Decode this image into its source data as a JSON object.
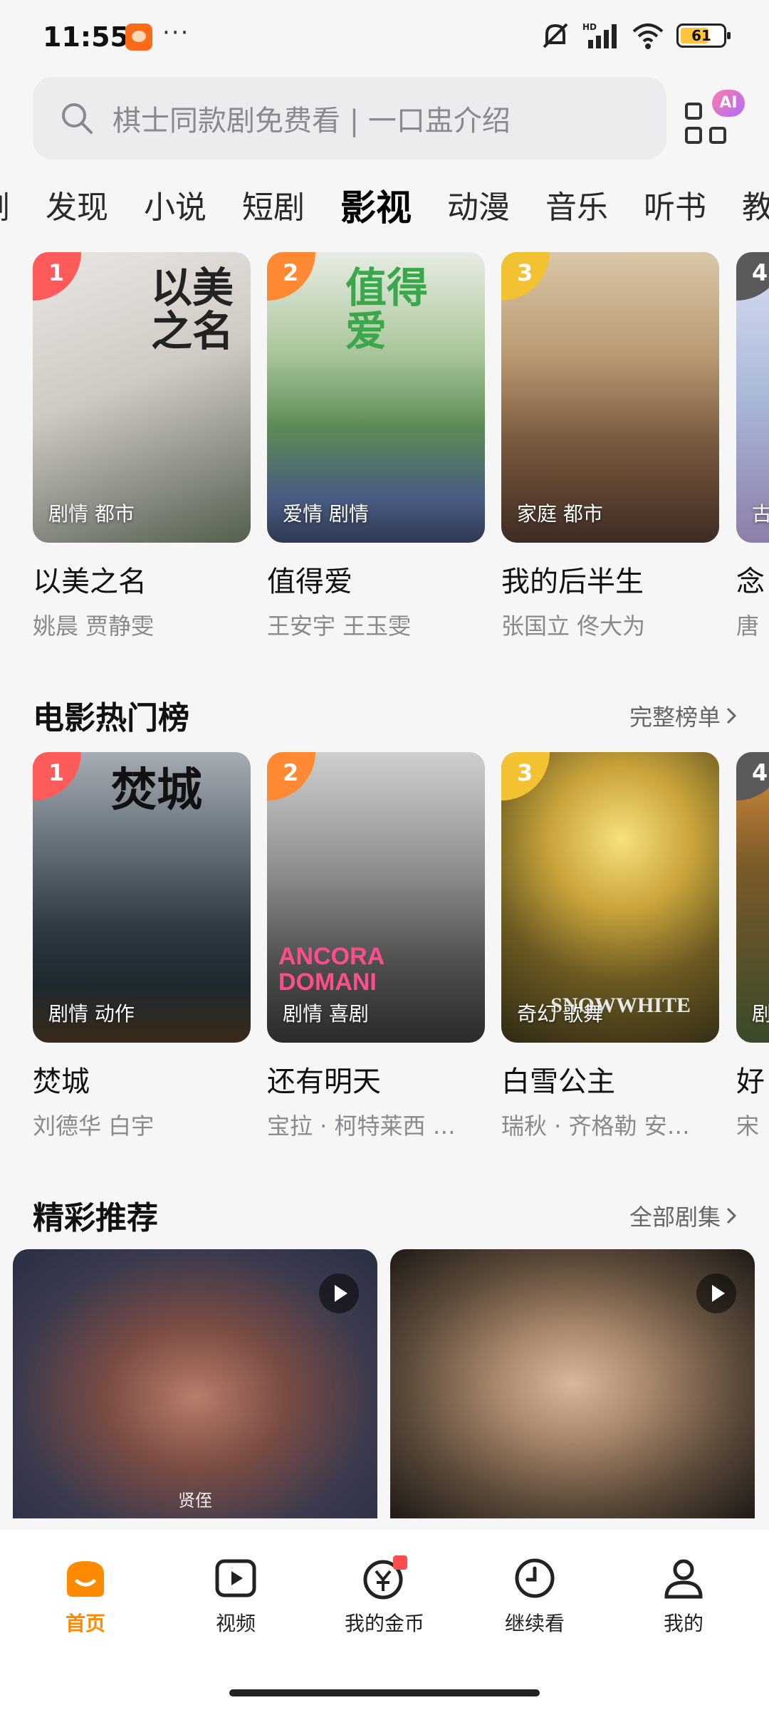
{
  "status_bar": {
    "time": "11:55",
    "dots": "···",
    "battery": "61",
    "battery_level": 0.61
  },
  "search": {
    "placeholder": "棋士同款剧免费看 | 一口盅介绍",
    "ai_badge": "AI"
  },
  "tabs": [
    {
      "label": "剧"
    },
    {
      "label": "发现"
    },
    {
      "label": "小说"
    },
    {
      "label": "短剧"
    },
    {
      "label": "影视",
      "active": true
    },
    {
      "label": "动漫"
    },
    {
      "label": "音乐"
    },
    {
      "label": "听书"
    },
    {
      "label": "教"
    }
  ],
  "drama_row": [
    {
      "rank": "1",
      "genre": "剧情 都市",
      "title": "以美之名",
      "cast": "姚晨 贾静雯",
      "art": "以美\n之名"
    },
    {
      "rank": "2",
      "genre": "爱情 剧情",
      "title": "值得爱",
      "cast": "王安宇 王玉雯",
      "art": "值得\n爱"
    },
    {
      "rank": "3",
      "genre": "家庭 都市",
      "title": "我的后半生",
      "cast": "张国立 佟大为",
      "art": ""
    },
    {
      "rank": "4",
      "genre": "古",
      "title": "念",
      "cast": "唐",
      "art": ""
    }
  ],
  "movie_section": {
    "title": "电影热门榜",
    "more": "完整榜单"
  },
  "movie_row": [
    {
      "rank": "1",
      "genre": "剧情 动作",
      "title": "焚城",
      "cast": "刘德华 白宇",
      "art": "焚城"
    },
    {
      "rank": "2",
      "genre": "剧情 喜剧",
      "title": "还有明天",
      "cast": "宝拉 · 柯特莱西 …",
      "art": "ANCORA DOMANI"
    },
    {
      "rank": "3",
      "genre": "奇幻 歌舞",
      "title": "白雪公主",
      "cast": "瑞秋 · 齐格勒 安…",
      "art": "SNOWWHITE"
    },
    {
      "rank": "4",
      "genre": "剧",
      "title": "好",
      "cast": "宋",
      "art": ""
    }
  ],
  "rec_section": {
    "title": "精彩推荐",
    "more": "全部剧集"
  },
  "rec_cards": [
    {
      "subtitle": "贤侄"
    },
    {
      "subtitle": ""
    }
  ],
  "bottom_nav": [
    {
      "label": "首页",
      "icon": "home-icon",
      "active": true
    },
    {
      "label": "视频",
      "icon": "video-icon"
    },
    {
      "label": "我的金币",
      "icon": "coin-icon"
    },
    {
      "label": "继续看",
      "icon": "clock-icon"
    },
    {
      "label": "我的",
      "icon": "profile-icon"
    }
  ],
  "colors": {
    "accent": "#ff8a00",
    "rank1": "#ff5b5b",
    "rank2": "#ff8a33",
    "rank3": "#f2c232"
  }
}
